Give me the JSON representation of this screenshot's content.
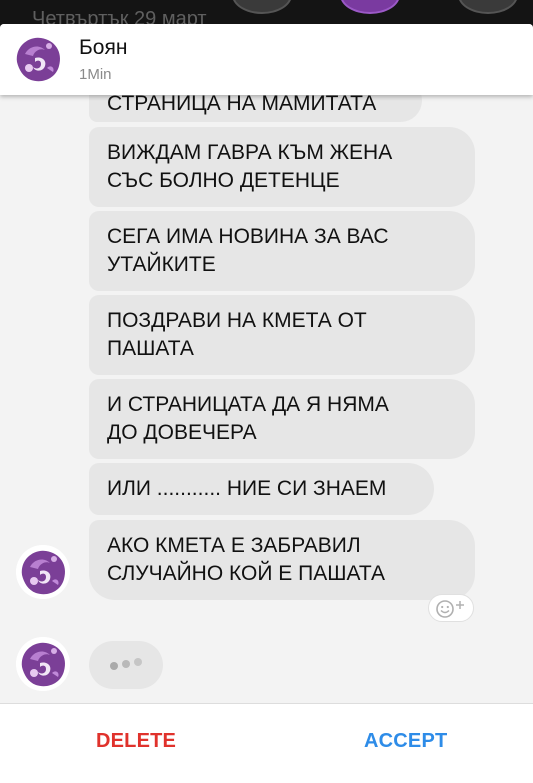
{
  "background": {
    "date_text": "Четвъртък 29 март"
  },
  "header": {
    "contact_name": "Боян",
    "time": "1Min"
  },
  "messages": [
    {
      "lines": [
        "СТРАНИЦА НА МАМИТАТА"
      ]
    },
    {
      "lines": [
        "ВИЖДАМ ГАВРА КЪМ ЖЕНА",
        "СЪС БОЛНО ДЕТЕНЦЕ"
      ]
    },
    {
      "lines": [
        "СЕГА ИМА НОВИНА ЗА ВАС",
        "УТАЙКИТЕ"
      ]
    },
    {
      "lines": [
        "ПОЗДРАВИ НА КМЕТА ОТ",
        "ПАШАТА"
      ]
    },
    {
      "lines": [
        "И СТРАНИЦАТА ДА Я НЯМА",
        "ДО ДОВЕЧЕРА"
      ]
    },
    {
      "lines": [
        "ИЛИ ........... НИЕ СИ ЗНАЕМ"
      ]
    },
    {
      "lines": [
        "АКО КМЕТА Е ЗАБРАВИЛ",
        "СЛУЧАЙНО КОЙ Е ПАШАТА"
      ]
    }
  ],
  "icons": {
    "add_reaction": "smiley-plus-icon",
    "typing": "typing-dots-icon"
  },
  "footer": {
    "delete_label": "DELETE",
    "accept_label": "ACCEPT"
  },
  "colors": {
    "delete": "#e0322c",
    "accept": "#2e8ce8",
    "bubble": "#e6e6e6"
  }
}
